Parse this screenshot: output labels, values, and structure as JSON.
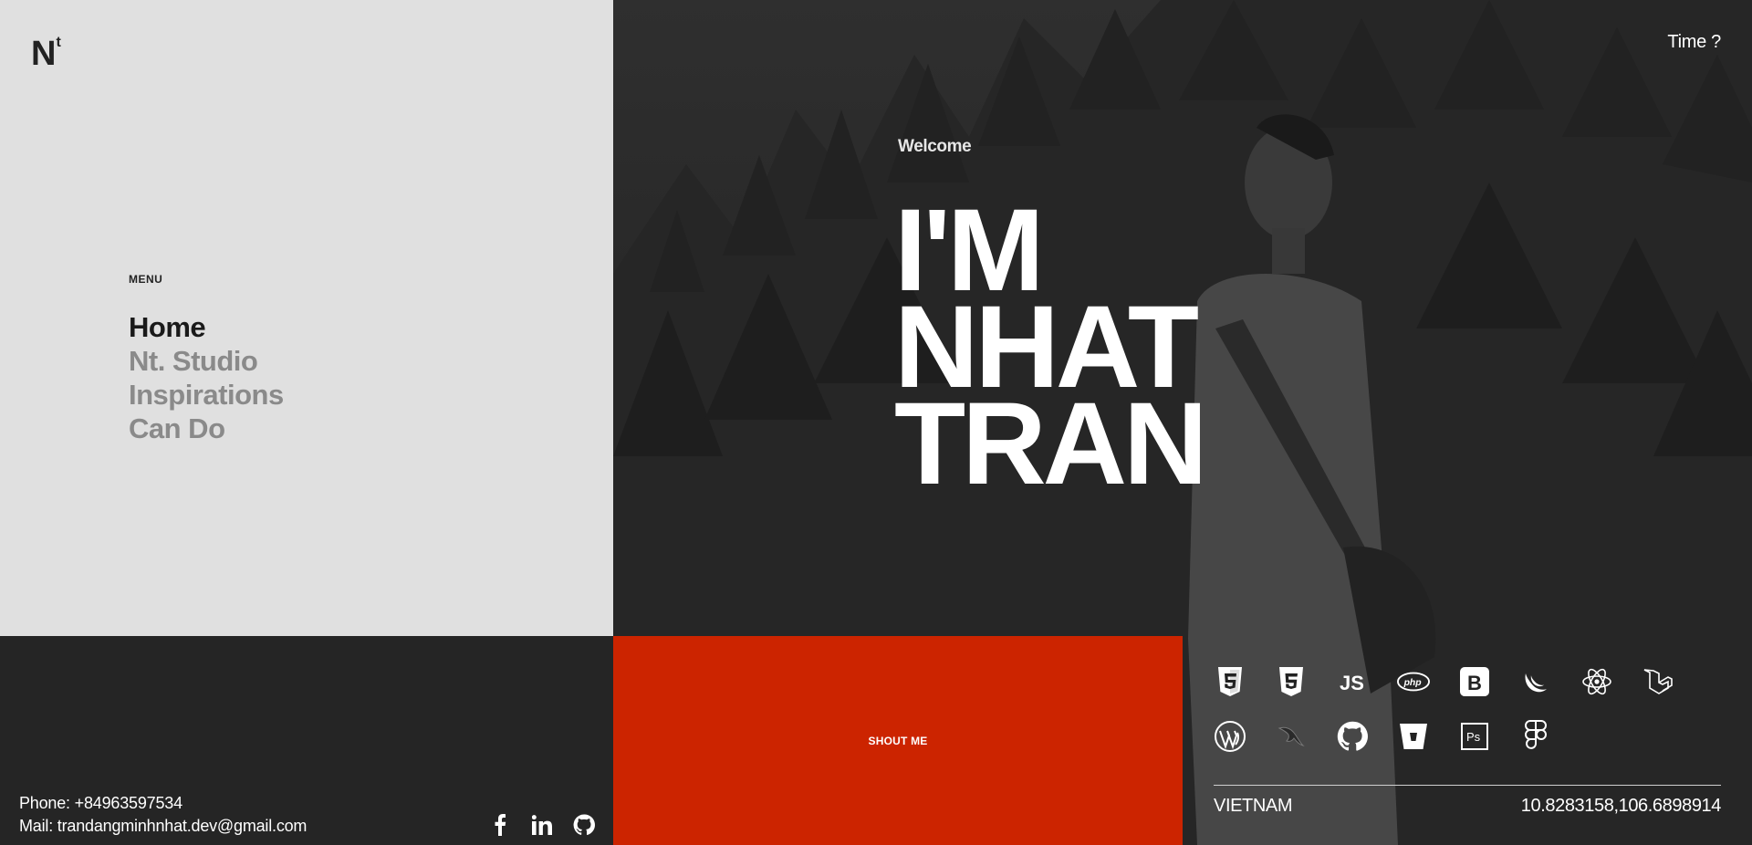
{
  "brand": {
    "logo_main": "N",
    "logo_sup": "t"
  },
  "menu": {
    "label": "MENU",
    "items": [
      {
        "label": "Home",
        "active": true
      },
      {
        "label": "Nt. Studio",
        "active": false
      },
      {
        "label": "Inspirations",
        "active": false
      },
      {
        "label": "Can Do",
        "active": false
      }
    ]
  },
  "contact": {
    "phone": "Phone: +84963597534",
    "mail": "Mail: trandangminhnhat.dev@gmail.com"
  },
  "socials": [
    "facebook-icon",
    "linkedin-icon",
    "github-icon"
  ],
  "hero": {
    "time_label": "Time ?",
    "welcome": "Welcome",
    "headline_1": "I'M",
    "headline_2": "NHAT",
    "headline_3": "TRAN"
  },
  "cta": {
    "label": "SHOUT ME"
  },
  "skills": {
    "row1": [
      "html5-icon",
      "css3-icon",
      "js-icon",
      "php-icon",
      "bootstrap-icon",
      "jquery-icon",
      "react-icon",
      "laravel-icon"
    ],
    "row2": [
      "wordpress-icon",
      "mysql-icon",
      "github-icon",
      "bitbucket-icon",
      "photoshop-icon",
      "figma-icon"
    ]
  },
  "location": {
    "country": "VIETNAM",
    "coords": "10.8283158,106.6898914"
  },
  "colors": {
    "accent": "#cc2400",
    "panel_light": "#e0e0e0",
    "panel_dark": "#252525"
  }
}
